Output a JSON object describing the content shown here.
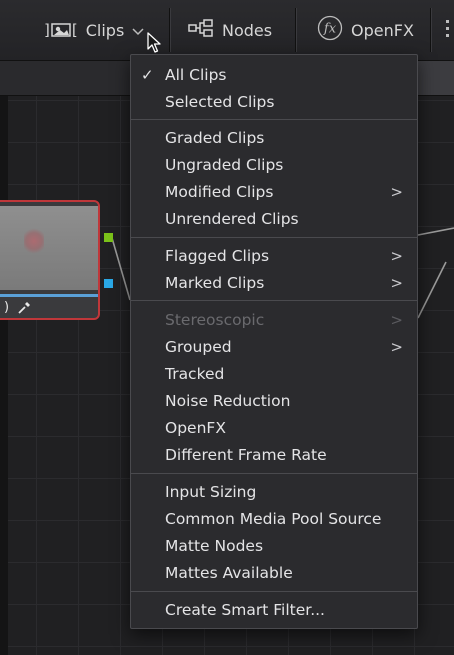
{
  "toolbar": {
    "clips_label": "Clips",
    "nodes_label": "Nodes",
    "openfx_label": "OpenFX"
  },
  "menu": {
    "items": [
      {
        "label": "All Clips",
        "checked": true
      },
      {
        "label": "Selected Clips"
      },
      {
        "label": "Graded Clips"
      },
      {
        "label": "Ungraded Clips"
      },
      {
        "label": "Modified Clips",
        "submenu": true
      },
      {
        "label": "Unrendered Clips"
      },
      {
        "label": "Flagged Clips",
        "submenu": true
      },
      {
        "label": "Marked Clips",
        "submenu": true
      },
      {
        "label": "Stereoscopic",
        "submenu": true,
        "disabled": true
      },
      {
        "label": "Grouped",
        "submenu": true
      },
      {
        "label": "Tracked"
      },
      {
        "label": "Noise Reduction"
      },
      {
        "label": "OpenFX"
      },
      {
        "label": "Different Frame Rate"
      },
      {
        "label": "Input Sizing"
      },
      {
        "label": "Common Media Pool Source"
      },
      {
        "label": "Matte Nodes"
      },
      {
        "label": "Mattes Available"
      },
      {
        "label": "Create Smart Filter..."
      }
    ]
  },
  "colors": {
    "node_border": "#c0373a",
    "rgb_port": "#7bc21a",
    "key_port": "#2aa8e6"
  }
}
